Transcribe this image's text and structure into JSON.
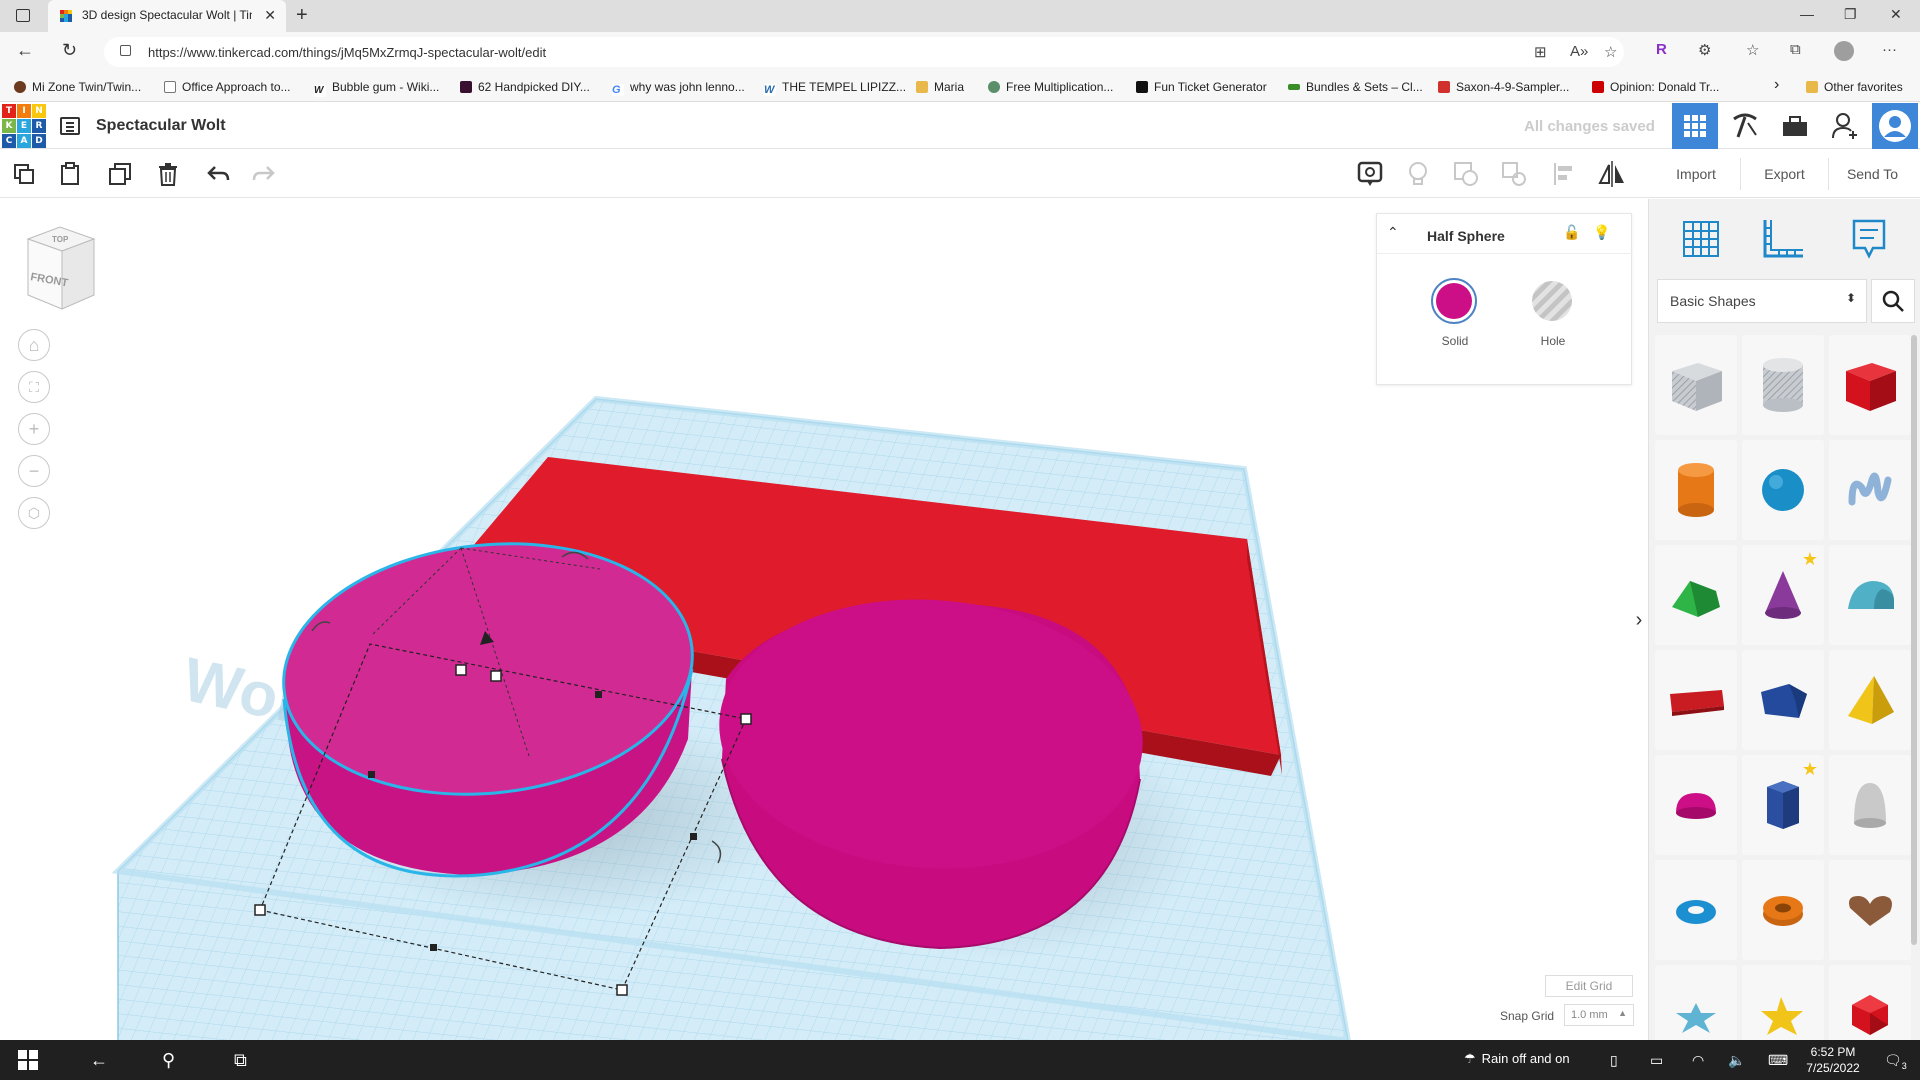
{
  "browser": {
    "tab_title": "3D design Spectacular Wolt | Tin",
    "tab_close": "✕",
    "new_tab": "+",
    "url": "https://www.tinkercad.com/things/jMq5MxZrmqJ-spectacular-wolt/edit",
    "window_controls": {
      "minimize": "—",
      "maximize": "❐",
      "close": "✕"
    },
    "nav": {
      "back": "←",
      "reload": "↻"
    },
    "profile_letter": "R",
    "more": "···",
    "bookmarks": [
      {
        "label": "Mi Zone Twin/Twin...",
        "color": "#6b3a1f"
      },
      {
        "label": "Office Approach to...",
        "color": "#777777"
      },
      {
        "label": "Bubble gum - Wiki...",
        "color": "#222222"
      },
      {
        "label": "62 Handpicked DIY...",
        "color": "#3a1030"
      },
      {
        "label": "why was john lenno...",
        "color": "#4285f4"
      },
      {
        "label": "THE TEMPEL LIPIZZ...",
        "color": "#2b6cb0"
      },
      {
        "label": "Maria",
        "color": "#e8b84a"
      },
      {
        "label": "Free Multiplication...",
        "color": "#5a8f6a"
      },
      {
        "label": "Fun Ticket Generator",
        "color": "#111111"
      },
      {
        "label": "Bundles & Sets – Cl...",
        "color": "#3c8c2b"
      },
      {
        "label": "Saxon-4-9-Sampler...",
        "color": "#d0312d"
      },
      {
        "label": "Opinion: Donald Tr...",
        "color": "#cc0000"
      }
    ],
    "bookmarks_more": "›",
    "other_favorites": "Other favorites"
  },
  "app": {
    "logo_letters": [
      "T",
      "I",
      "N",
      "K",
      "E",
      "R",
      "C",
      "A",
      "D"
    ],
    "logo_colors": [
      "#e2231a",
      "#f27d0c",
      "#f9c80e",
      "#7ab648",
      "#2aa6df",
      "#1d5aa8",
      "#1d5aa8",
      "#2aa6df",
      "#1d5aa8"
    ],
    "project_title": "Spectacular Wolt",
    "save_status": "All changes saved",
    "accent": "#3d86d8"
  },
  "toolbar": {
    "import": "Import",
    "export": "Export",
    "send_to": "Send To"
  },
  "workspace": {
    "viewcube_top": "TOP",
    "viewcube_front": "FRONT",
    "workplane_label": "Workplane",
    "colors": {
      "grid": "#bfe3f3",
      "box": "#e01b2b",
      "half_sphere": "#cc0f86",
      "selection": "#2ab5e8"
    }
  },
  "inspector": {
    "title": "Half Sphere",
    "solid_label": "Solid",
    "hole_label": "Hole",
    "solid_color": "#cc0f86"
  },
  "grid_controls": {
    "edit_grid": "Edit Grid",
    "snap_label": "Snap Grid",
    "snap_value": "1.0 mm"
  },
  "library": {
    "category": "Basic Shapes",
    "shapes": [
      {
        "name": "box-hole",
        "color": "#b9bfc6"
      },
      {
        "name": "cylinder-hole",
        "color": "#c4c8cc"
      },
      {
        "name": "box",
        "color": "#d3121d"
      },
      {
        "name": "cylinder",
        "color": "#e67817"
      },
      {
        "name": "sphere",
        "color": "#1a8fc7"
      },
      {
        "name": "scribble",
        "color": "#8fb3d8"
      },
      {
        "name": "roof",
        "color": "#26a03a"
      },
      {
        "name": "cone",
        "color": "#8a3a9a"
      },
      {
        "name": "round-roof",
        "color": "#4fb0c6"
      },
      {
        "name": "text",
        "color": "#c81b22"
      },
      {
        "name": "polygon",
        "color": "#234a9c"
      },
      {
        "name": "pyramid",
        "color": "#f0c419"
      },
      {
        "name": "half-sphere",
        "color": "#cc0f86"
      },
      {
        "name": "hexagonal-prism",
        "color": "#2a4fa0"
      },
      {
        "name": "paraboloid",
        "color": "#c9c9c9"
      },
      {
        "name": "torus",
        "color": "#1b8fd0"
      },
      {
        "name": "tube",
        "color": "#e67817"
      },
      {
        "name": "heart",
        "color": "#8b5a3a"
      },
      {
        "name": "star",
        "color": "#5fb4d4"
      },
      {
        "name": "star-gold",
        "color": "#f0c419"
      },
      {
        "name": "icosahedron",
        "color": "#d3121d"
      }
    ]
  },
  "taskbar": {
    "weather": "Rain off and on",
    "time": "6:52 PM",
    "date": "7/25/2022",
    "notification_count": "3"
  }
}
